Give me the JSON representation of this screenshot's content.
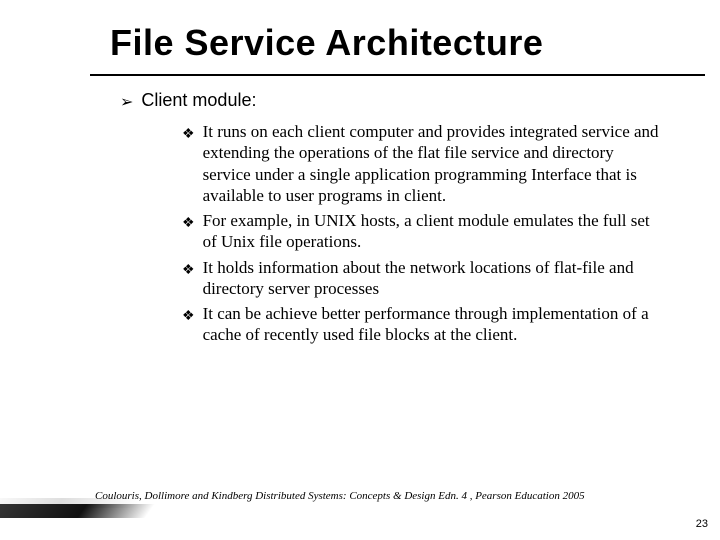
{
  "title": "File Service Architecture",
  "section": {
    "bullet_glyph": "➢",
    "label": "Client module:"
  },
  "sub_bullet_glyph": "❖",
  "points": [
    "It runs on each client computer and provides integrated service and extending the operations of the flat file service and directory service under  a single application programming Interface that is available to  user  programs in client.",
    " For example, in UNIX hosts, a client module emulates the full set of Unix file operations.",
    "It holds information about the network locations of flat-file and directory server processes",
    "It can be achieve better performance through implementation of a cache of recently used file blocks at the client."
  ],
  "citation": "Coulouris, Dollimore and Kindberg  Distributed Systems: Concepts & Design  Edn. 4 , Pearson Education 2005",
  "page_number": "23"
}
